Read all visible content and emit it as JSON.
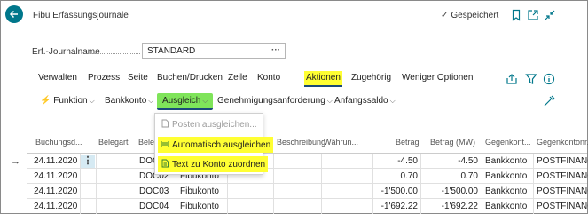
{
  "header": {
    "title": "Fibu Erfassungsjournale",
    "saved_status": "Gespeichert"
  },
  "fields": {
    "journal_name_label": "Erf.-Journalname",
    "journal_name_value": "STANDARD"
  },
  "tabs": [
    "Verwalten",
    "Prozess",
    "Seite",
    "Buchen/Drucken",
    "Zeile",
    "Konto",
    "Aktionen",
    "Zugehörig",
    "Weniger Optionen"
  ],
  "active_tab": "Aktionen",
  "commands": {
    "funktion": "Funktion",
    "bankkonto": "Bankkonto",
    "ausgleich": "Ausgleich",
    "genehmigung": "Genehmigungsanforderung",
    "anfangssaldo": "Anfangssaldo"
  },
  "ausgleich_menu": {
    "items": [
      {
        "label": "Posten ausgleichen...",
        "enabled": false
      },
      {
        "label": "Automatisch ausgleichen",
        "enabled": true,
        "highlighted": true
      },
      {
        "label": "Text zu Konto zuordnen",
        "enabled": true,
        "highlighted": true
      }
    ]
  },
  "table": {
    "headers": [
      "Buchungsd...",
      "Belegart",
      "Beleg",
      "",
      "",
      "Beschreibung",
      "Währun...",
      "Betrag",
      "Betrag (MW)",
      "Gegenkont...",
      "Gegenkontonr."
    ],
    "rows": [
      {
        "date": "24.11.2020",
        "doc": "DOC0",
        "account_type": "",
        "amount": "-4.50",
        "amount_lcy": "-4.50",
        "bal_type": "Bankkonto",
        "bal_no": "POSTFINANCE"
      },
      {
        "date": "24.11.2020",
        "doc": "DOC02",
        "account_type": "Fibukonto",
        "amount": "0.70",
        "amount_lcy": "0.70",
        "bal_type": "Bankkonto",
        "bal_no": "POSTFINANCE"
      },
      {
        "date": "24.11.2020",
        "doc": "DOC03",
        "account_type": "Fibukonto",
        "amount": "-1'500.00",
        "amount_lcy": "-1'500.00",
        "bal_type": "Bankkonto",
        "bal_no": "POSTFINANCE"
      },
      {
        "date": "24.11.2020",
        "doc": "DOC04",
        "account_type": "Fibukonto",
        "amount": "-1'692.22",
        "amount_lcy": "-1'692.22",
        "bal_type": "Bankkonto",
        "bal_no": "POSTFINANCE"
      }
    ]
  },
  "colors": {
    "accent": "#00778b",
    "highlight_yellow": "#ffff33",
    "highlight_green": "#7fe45a",
    "row_menu_bg": "#d6eaf3"
  }
}
